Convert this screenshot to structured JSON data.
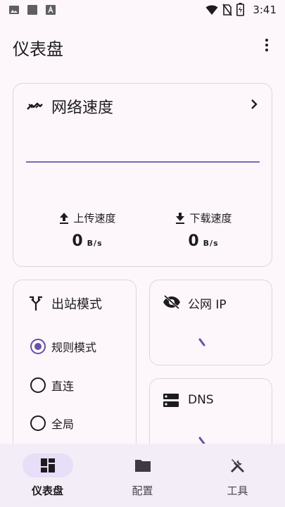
{
  "status_bar": {
    "time": "3:41",
    "icons": [
      "image-icon",
      "square-icon",
      "font-a-icon",
      "wifi-icon",
      "no-sim-icon",
      "battery-charging-icon"
    ]
  },
  "app_bar": {
    "title": "仪表盘",
    "menu_icon": "more-vert-icon"
  },
  "speed_card": {
    "title": "网络速度",
    "upload": {
      "label": "上传速度",
      "value": "0",
      "unit": "B/s"
    },
    "download": {
      "label": "下载速度",
      "value": "0",
      "unit": "B/s"
    }
  },
  "mode_card": {
    "title": "出站模式",
    "options": [
      {
        "label": "规则模式",
        "selected": true
      },
      {
        "label": "直连",
        "selected": false
      },
      {
        "label": "全局",
        "selected": false
      }
    ]
  },
  "ip_card": {
    "title": "公网 IP"
  },
  "dns_card": {
    "title": "DNS"
  },
  "bottom_nav": {
    "items": [
      {
        "label": "仪表盘",
        "active": true
      },
      {
        "label": "配置",
        "active": false
      },
      {
        "label": "工具",
        "active": false
      }
    ]
  },
  "colors": {
    "accent": "#6750a4",
    "line": "#7b6aab",
    "background": "#fdf7fc",
    "nav_background": "#f3edf7",
    "nav_active_pill": "#e8def8"
  }
}
